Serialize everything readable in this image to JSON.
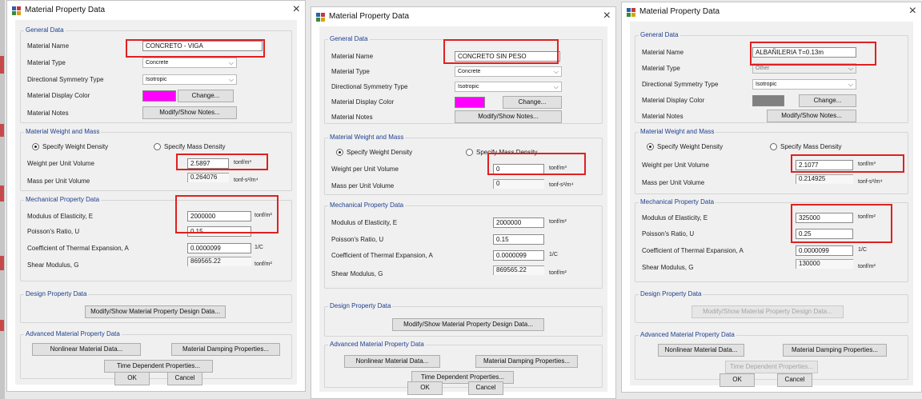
{
  "dialogs": [
    {
      "title": "Material Property Data",
      "general": {
        "group_title": "General Data",
        "name_label": "Material Name",
        "name_value": "CONCRETO - VIGA",
        "type_label": "Material Type",
        "type_value": "Concrete",
        "symmetry_label": "Directional Symmetry Type",
        "symmetry_value": "Isotropic",
        "color_label": "Material Display Color",
        "color": "#ff00ff",
        "change_label": "Change...",
        "notes_label": "Material Notes",
        "notes_button": "Modify/Show Notes..."
      },
      "weight": {
        "group_title": "Material Weight and Mass",
        "radio_weight": "Specify Weight Density",
        "radio_mass": "Specify Mass Density",
        "weight_label": "Weight per Unit Volume",
        "weight_value": "2.5897",
        "weight_unit": "tonf/m³",
        "mass_label": "Mass per Unit Volume",
        "mass_value": "0.264076",
        "mass_unit": "tonf-s²/m⁴"
      },
      "mech": {
        "group_title": "Mechanical Property Data",
        "e_label": "Modulus of Elasticity,  E",
        "e_value": "2000000",
        "e_unit": "tonf/m²",
        "u_label": "Poisson's Ratio,  U",
        "u_value": "0.15",
        "a_label": "Coefficient of Thermal Expansion,  A",
        "a_value": "0.0000099",
        "a_unit": "1/C",
        "g_label": "Shear Modulus,  G",
        "g_value": "869565.22",
        "g_unit": "tonf/m²"
      },
      "design": {
        "group_title": "Design Property Data",
        "button": "Modify/Show Material Property Design Data..."
      },
      "advanced": {
        "group_title": "Advanced Material Property Data",
        "nonlinear": "Nonlinear Material Data...",
        "damping": "Material Damping Properties...",
        "time": "Time Dependent Properties..."
      },
      "ok": "OK",
      "cancel": "Cancel"
    },
    {
      "title": "Material Property Data",
      "general": {
        "group_title": "General Data",
        "name_label": "Material Name",
        "name_value": "CONCRETO SIN PESO",
        "type_label": "Material Type",
        "type_value": "Concrete",
        "symmetry_label": "Directional Symmetry Type",
        "symmetry_value": "Isotropic",
        "color_label": "Material Display Color",
        "color": "#ff00ff",
        "change_label": "Change...",
        "notes_label": "Material Notes",
        "notes_button": "Modify/Show Notes..."
      },
      "weight": {
        "group_title": "Material Weight and Mass",
        "radio_weight": "Specify Weight Density",
        "radio_mass": "Specify Mass Density",
        "weight_label": "Weight per Unit Volume",
        "weight_value": "0",
        "weight_unit": "tonf/m³",
        "mass_label": "Mass per Unit Volume",
        "mass_value": "0",
        "mass_unit": "tonf-s²/m⁴"
      },
      "mech": {
        "group_title": "Mechanical Property Data",
        "e_label": "Modulus of Elasticity,  E",
        "e_value": "2000000",
        "e_unit": "tonf/m²",
        "u_label": "Poisson's Ratio,  U",
        "u_value": "0.15",
        "a_label": "Coefficient of Thermal Expansion,  A",
        "a_value": "0.0000099",
        "a_unit": "1/C",
        "g_label": "Shear Modulus,  G",
        "g_value": "869565.22",
        "g_unit": "tonf/m²"
      },
      "design": {
        "group_title": "Design Property Data",
        "button": "Modify/Show Material Property Design Data..."
      },
      "advanced": {
        "group_title": "Advanced Material Property Data",
        "nonlinear": "Nonlinear Material Data...",
        "damping": "Material Damping Properties...",
        "time": "Time Dependent Properties..."
      },
      "ok": "OK",
      "cancel": "Cancel"
    },
    {
      "title": "Material Property Data",
      "general": {
        "group_title": "General Data",
        "name_label": "Material Name",
        "name_value": "ALBAÑILERIA T=0.13m",
        "type_label": "Material Type",
        "type_value": "Other",
        "symmetry_label": "Directional Symmetry Type",
        "symmetry_value": "Isotropic",
        "color_label": "Material Display Color",
        "color": "#808080",
        "change_label": "Change...",
        "notes_label": "Material Notes",
        "notes_button": "Modify/Show Notes..."
      },
      "weight": {
        "group_title": "Material Weight and Mass",
        "radio_weight": "Specify Weight Density",
        "radio_mass": "Specify Mass Density",
        "weight_label": "Weight per Unit Volume",
        "weight_value": "2.1077",
        "weight_unit": "tonf/m³",
        "mass_label": "Mass per Unit Volume",
        "mass_value": "0.214925",
        "mass_unit": "tonf-s²/m⁴"
      },
      "mech": {
        "group_title": "Mechanical Property Data",
        "e_label": "Modulus of Elasticity,  E",
        "e_value": "325000",
        "e_unit": "tonf/m²",
        "u_label": "Poisson's Ratio,  U",
        "u_value": "0.25",
        "a_label": "Coefficient of Thermal Expansion,  A",
        "a_value": "0.0000099",
        "a_unit": "1/C",
        "g_label": "Shear Modulus,  G",
        "g_value": "130000",
        "g_unit": "tonf/m²"
      },
      "design": {
        "group_title": "Design Property Data",
        "button": "Modify/Show Material Property Design Data..."
      },
      "advanced": {
        "group_title": "Advanced Material Property Data",
        "nonlinear": "Nonlinear Material Data...",
        "damping": "Material Damping Properties...",
        "time": "Time Dependent Properties..."
      },
      "ok": "OK",
      "cancel": "Cancel"
    }
  ]
}
